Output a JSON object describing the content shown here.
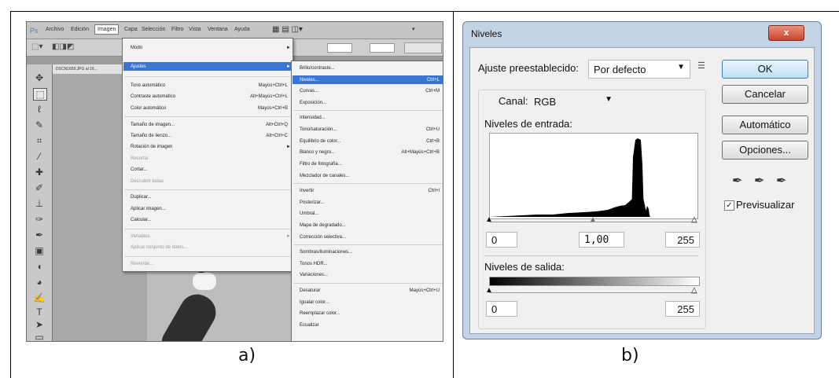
{
  "captions": {
    "a": "a)",
    "b": "b)"
  },
  "photoshop": {
    "menubar": [
      "Archivo",
      "Edición",
      "Imagen",
      "Capa",
      "Selección",
      "Filtro",
      "Vista",
      "Ventana",
      "Ayuda"
    ],
    "doc_tab": "DSCN1659.JPG al 16...",
    "image_menu": [
      {
        "label": "Modo",
        "sc": "",
        "submenu": true
      },
      {
        "label": "Ajustes",
        "sc": "",
        "submenu": true,
        "selected": true
      },
      {
        "label": "Tono automático",
        "sc": "Mayús+Ctrl+L"
      },
      {
        "label": "Contraste automático",
        "sc": "Alt+Mayús+Ctrl+L"
      },
      {
        "label": "Color automático",
        "sc": "Mayús+Ctrl+B"
      },
      {
        "label": "Tamaño de imagen...",
        "sc": "Alt+Ctrl+Q"
      },
      {
        "label": "Tamaño de lienzo...",
        "sc": "Alt+Ctrl+C"
      },
      {
        "label": "Rotación de imagen",
        "sc": "",
        "submenu": true
      },
      {
        "label": "Recortar",
        "sc": "",
        "disabled": true
      },
      {
        "label": "Cortar...",
        "sc": ""
      },
      {
        "label": "Descubrir todas",
        "sc": "",
        "disabled": true
      },
      {
        "label": "Duplicar...",
        "sc": ""
      },
      {
        "label": "Aplicar imagen...",
        "sc": ""
      },
      {
        "label": "Calcular...",
        "sc": ""
      },
      {
        "label": "Variables",
        "sc": "",
        "submenu": true,
        "disabled": true
      },
      {
        "label": "Aplicar conjunto de datos...",
        "sc": "",
        "disabled": true
      },
      {
        "label": "Reventar...",
        "sc": "",
        "disabled": true
      }
    ],
    "adjust_menu": [
      {
        "label": "Brillo/contraste...",
        "sc": ""
      },
      {
        "label": "Niveles...",
        "sc": "Ctrl+L",
        "selected": true
      },
      {
        "label": "Curvas...",
        "sc": "Ctrl+M"
      },
      {
        "label": "Exposición...",
        "sc": ""
      },
      {
        "label": "Intensidad...",
        "sc": ""
      },
      {
        "label": "Tono/saturación...",
        "sc": "Ctrl+U"
      },
      {
        "label": "Equilibrio de color...",
        "sc": "Ctrl+B"
      },
      {
        "label": "Blanco y negro...",
        "sc": "Alt+Mayús+Ctrl+B"
      },
      {
        "label": "Filtro de fotografía...",
        "sc": ""
      },
      {
        "label": "Mezclador de canales...",
        "sc": ""
      },
      {
        "label": "Invertir",
        "sc": "Ctrl+I"
      },
      {
        "label": "Posterizar...",
        "sc": ""
      },
      {
        "label": "Umbral...",
        "sc": ""
      },
      {
        "label": "Mapa de degradado...",
        "sc": ""
      },
      {
        "label": "Corrección selectiva...",
        "sc": ""
      },
      {
        "label": "Sombras/iluminaciones...",
        "sc": ""
      },
      {
        "label": "Tonos HDR...",
        "sc": ""
      },
      {
        "label": "Variaciones...",
        "sc": ""
      },
      {
        "label": "Desaturar",
        "sc": "Mayús+Ctrl+U"
      },
      {
        "label": "Igualar color...",
        "sc": ""
      },
      {
        "label": "Reemplazar color...",
        "sc": ""
      },
      {
        "label": "Ecualizar",
        "sc": ""
      }
    ]
  },
  "levels_dialog": {
    "title": "Niveles",
    "close": "x",
    "preset_label": "Ajuste preestablecido:",
    "preset_value": "Por defecto",
    "channel_label": "Canal:",
    "channel_value": "RGB",
    "input_label": "Niveles de entrada:",
    "input_black": "0",
    "input_gamma": "1,00",
    "input_white": "255",
    "output_label": "Niveles de salida:",
    "output_black": "0",
    "output_white": "255",
    "ok": "OK",
    "cancel": "Cancelar",
    "auto": "Automático",
    "options": "Opciones...",
    "preview_label": "Previsualizar",
    "preview_checked": true
  }
}
